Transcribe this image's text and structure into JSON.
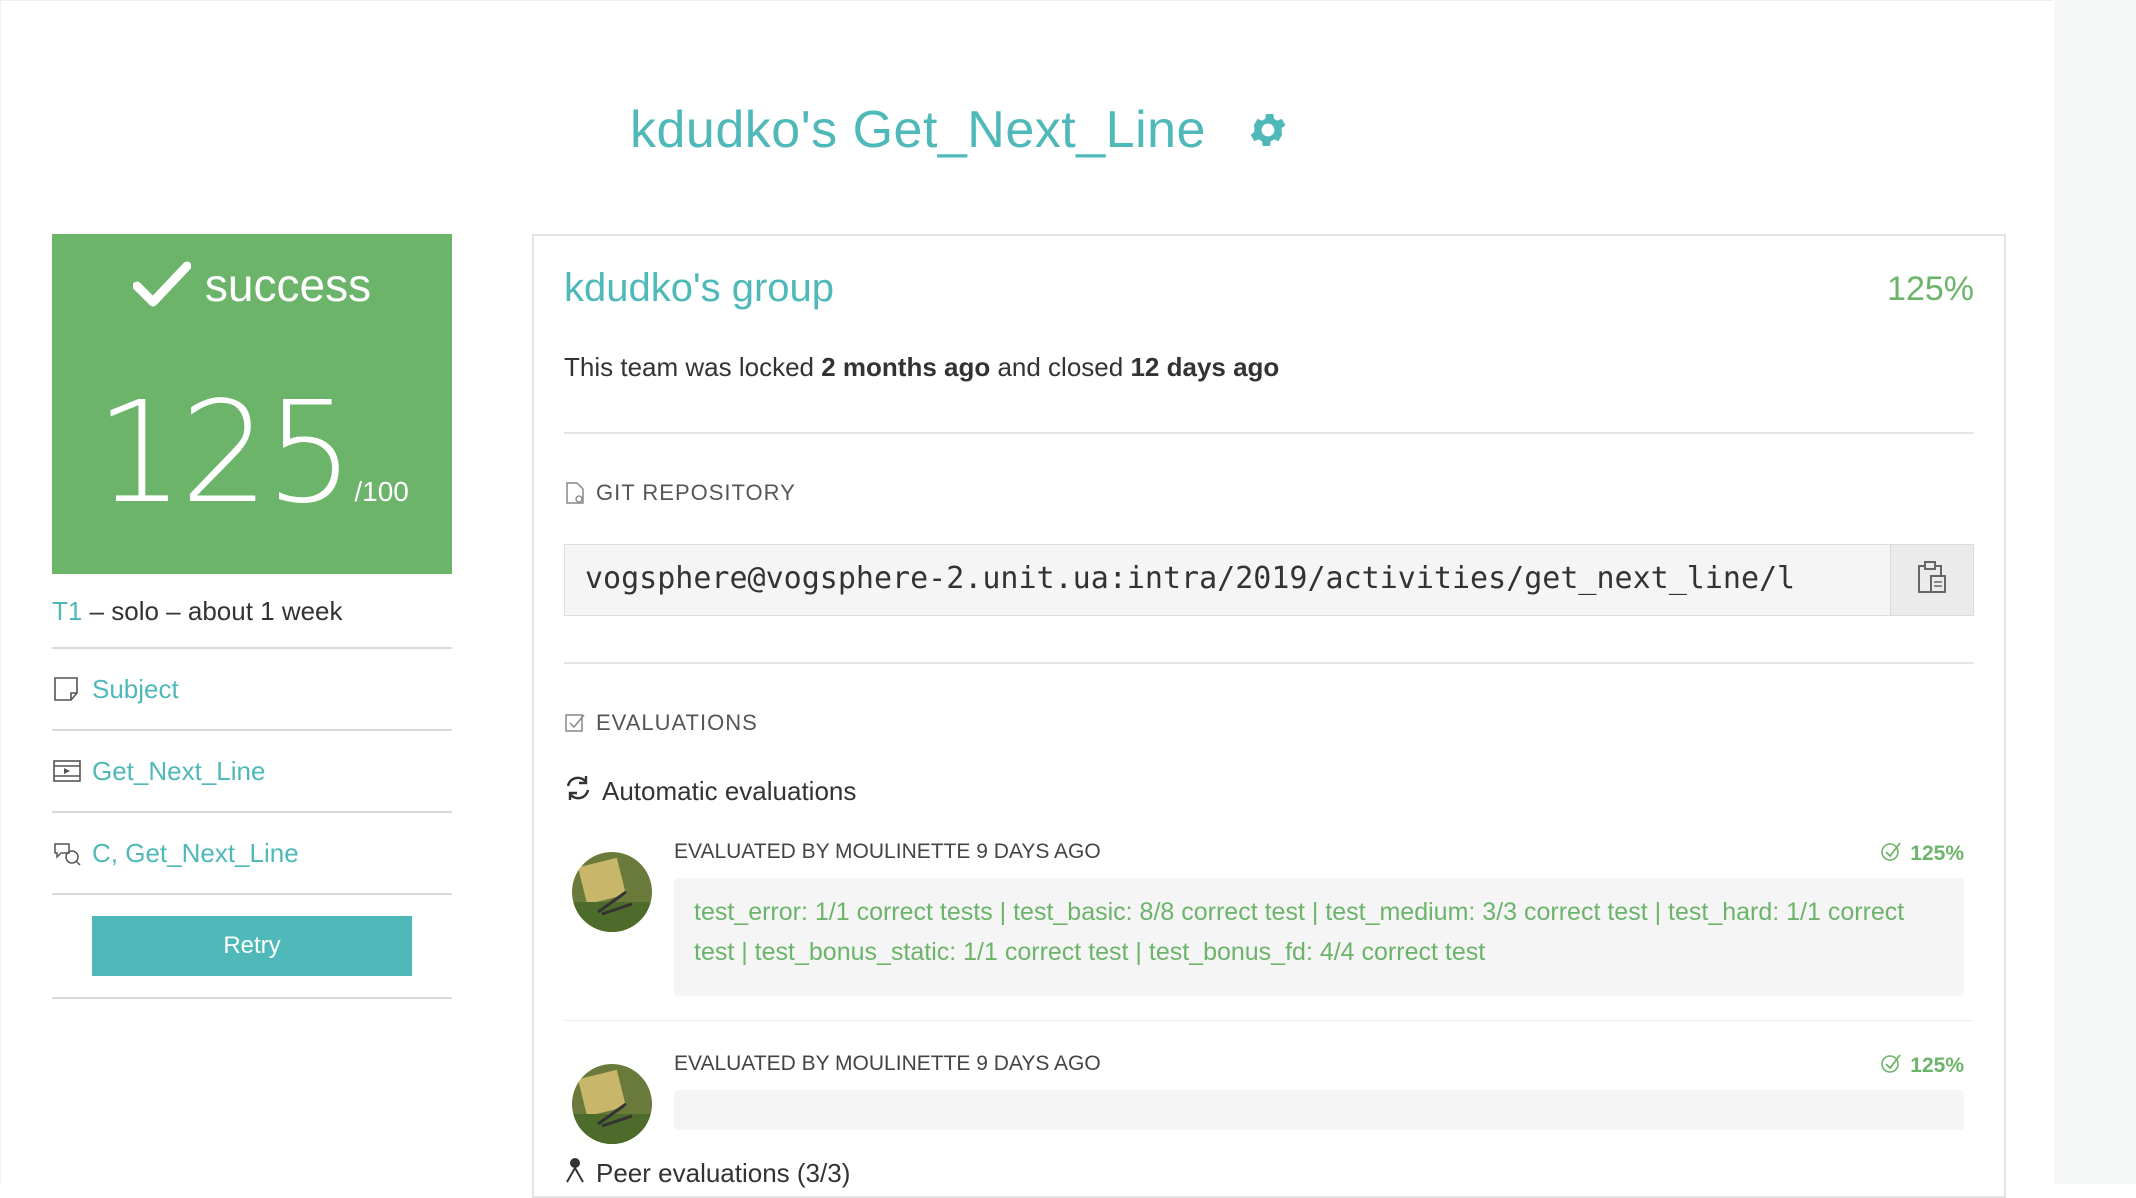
{
  "header": {
    "title": "kdudko's Get_Next_Line",
    "settings_icon": "gear-icon"
  },
  "colors": {
    "accent": "#4fb8b8",
    "success": "#6bb46a"
  },
  "status_card": {
    "label": "success",
    "score": "125",
    "max": "/100"
  },
  "meta": {
    "tier": "T1",
    "info": " – solo – about 1 week"
  },
  "links": [
    {
      "label": "Subject",
      "icon": "document-icon"
    },
    {
      "label": "Get_Next_Line",
      "icon": "video-icon"
    },
    {
      "label": "C, Get_Next_Line",
      "icon": "chat-icon"
    }
  ],
  "actions": {
    "retry_label": "Retry"
  },
  "team": {
    "name": "kdudko's group",
    "percent": "125%",
    "status_prefix": "This team was locked ",
    "locked_ago": "2 months ago",
    "status_middle": " and closed ",
    "closed_ago": "12 days ago"
  },
  "git": {
    "section_label": "GIT REPOSITORY",
    "url": "vogsphere@vogsphere-2.unit.ua:intra/2019/activities/get_next_line/l"
  },
  "evaluations": {
    "section_label": "EVALUATIONS",
    "automatic_label": "Automatic evaluations",
    "items": [
      {
        "by": "EVALUATED BY MOULINETTE 9 DAYS AGO",
        "percent": "125%",
        "body": "test_error: 1/1 correct tests | test_basic: 8/8 correct test | test_medium: 3/3 correct test | test_hard: 1/1 correct test | test_bonus_static: 1/1 correct test | test_bonus_fd: 4/4 correct test"
      },
      {
        "by": "EVALUATED BY MOULINETTE 9 DAYS AGO",
        "percent": "125%",
        "body": ""
      }
    ],
    "peer_label": "Peer evaluations (3/3)"
  }
}
